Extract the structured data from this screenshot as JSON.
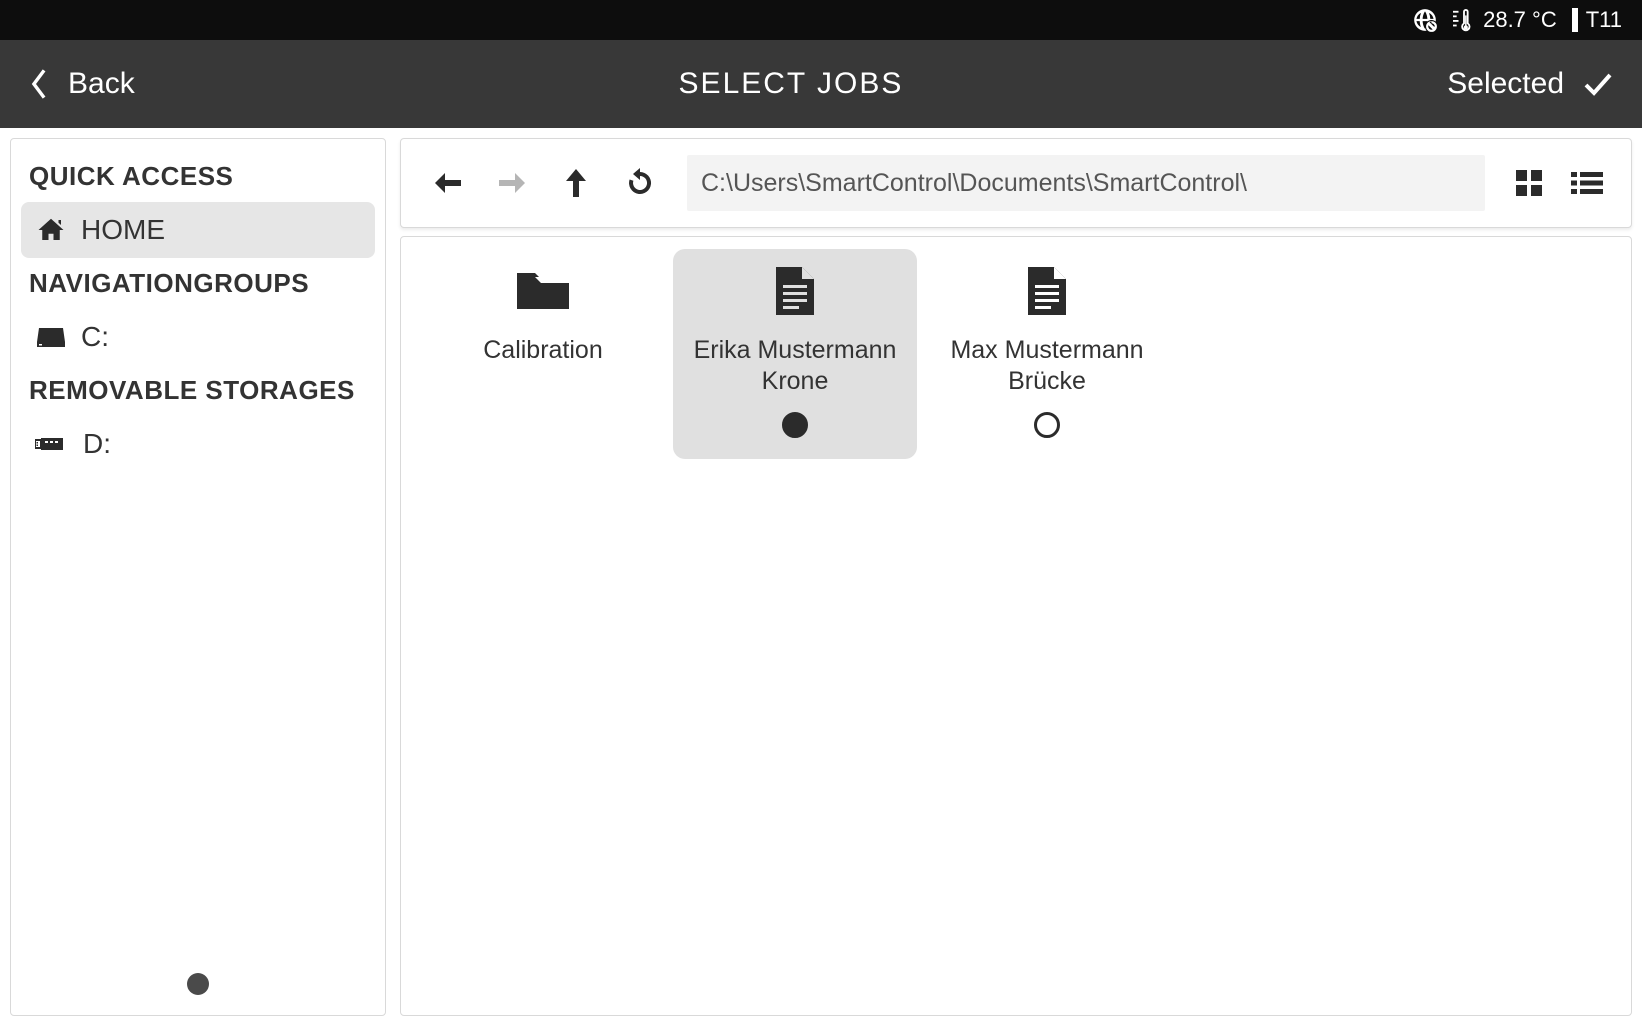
{
  "statusbar": {
    "temperature": "28.7 °C",
    "t_label": "T11"
  },
  "titlebar": {
    "back_label": "Back",
    "title": "SELECT JOBS",
    "selected_label": "Selected"
  },
  "sidebar": {
    "quick_access_label": "QUICK ACCESS",
    "home_label": "HOME",
    "navigationgroups_label": "NAVIGATIONGROUPS",
    "drive_c_label": "C:",
    "removable_storages_label": "REMOVABLE STORAGES",
    "drive_d_label": "D:"
  },
  "toolbar": {
    "path": "C:\\Users\\SmartControl\\Documents\\SmartControl\\"
  },
  "files": {
    "items": [
      {
        "label": "Calibration",
        "type": "folder",
        "selected": false
      },
      {
        "label": "Erika Mustermann Krone",
        "type": "file",
        "selected": true
      },
      {
        "label": "Max Mustermann Brücke",
        "type": "file",
        "selected": false
      }
    ]
  }
}
